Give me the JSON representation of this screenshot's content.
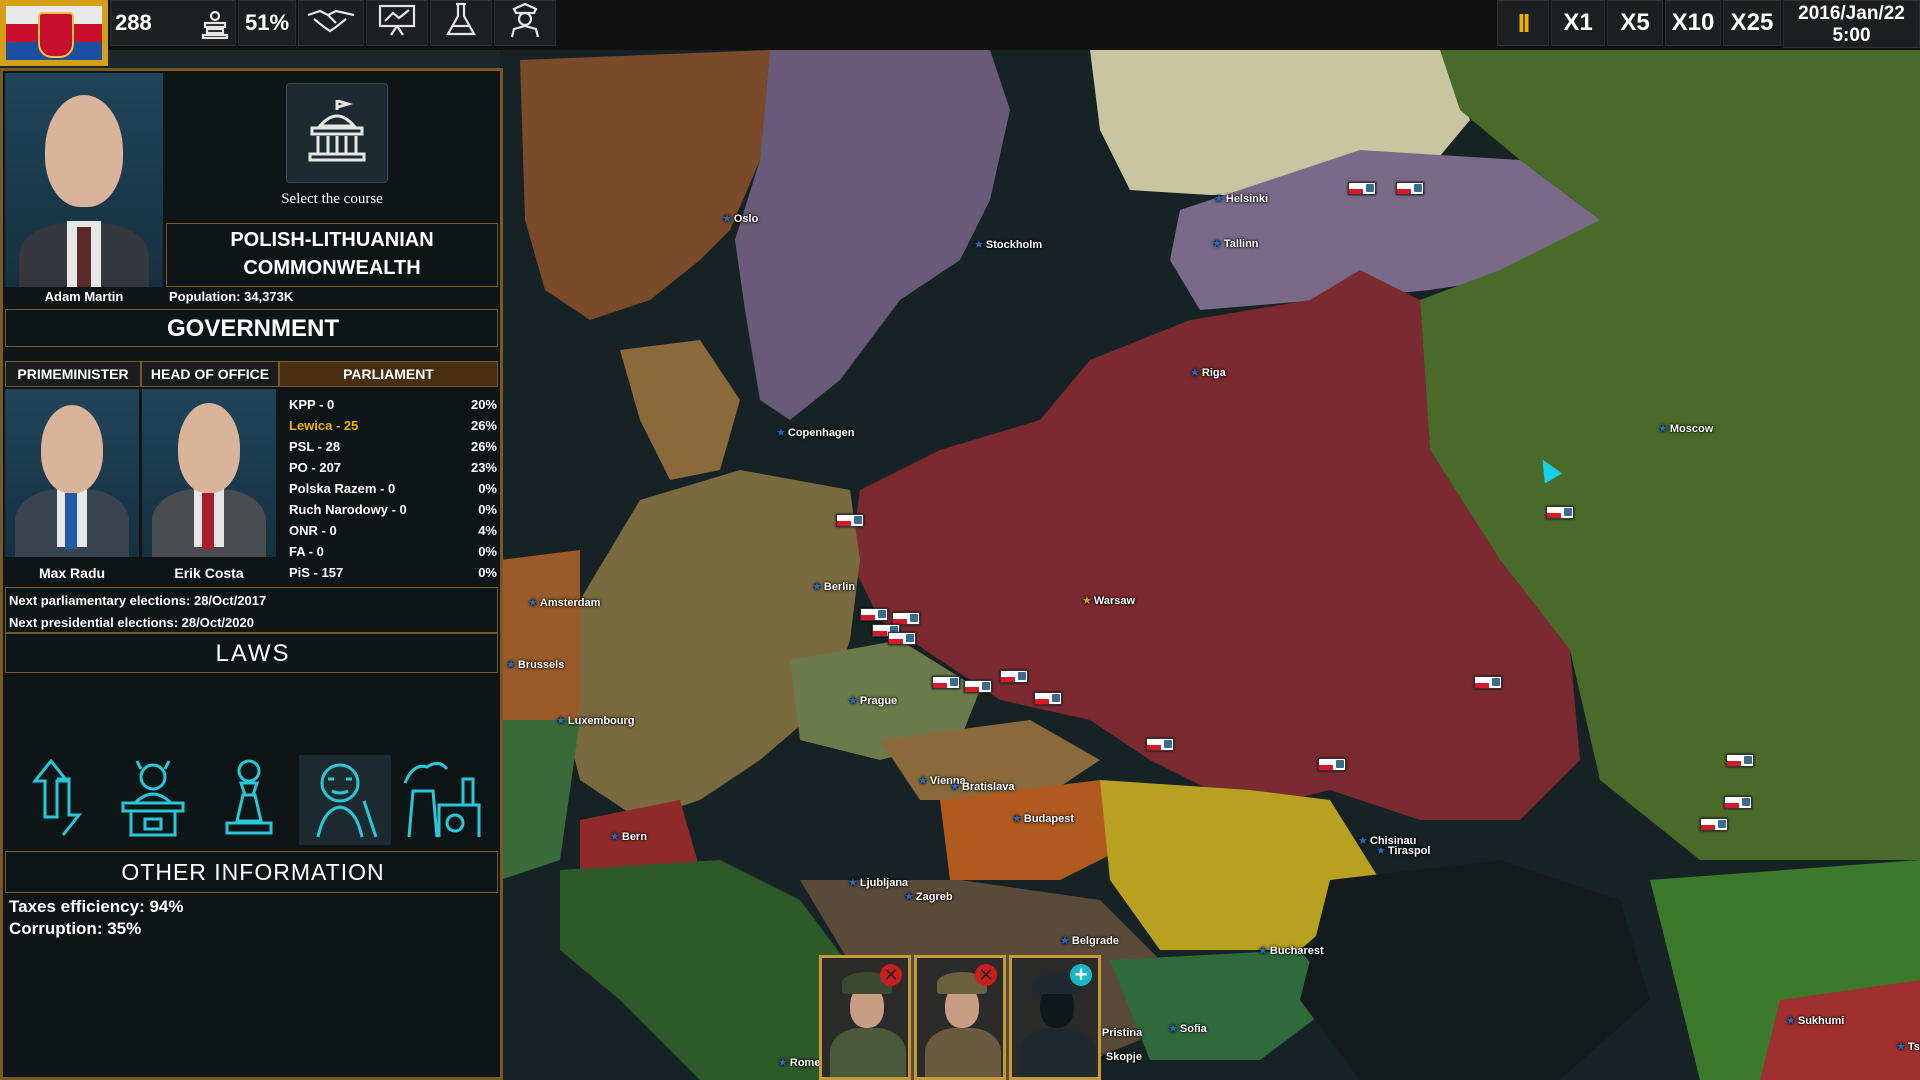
{
  "top_bar": {
    "resource_value": "288",
    "support_percent": "51%",
    "speed_buttons": [
      "X1",
      "X5",
      "X10",
      "X25"
    ],
    "pause_symbol": "II",
    "date": "2016/Jan/22",
    "time": "5:00",
    "icons": [
      "flag-icon",
      "tax-icon",
      "handshake-icon",
      "presentation-chart-icon",
      "flask-icon",
      "general-icon"
    ]
  },
  "leader": {
    "name": "Adam Martin",
    "course_label": "Select the course",
    "country_line1": "POLISH-LITHUANIAN",
    "country_line2": "COMMONWEALTH",
    "population": "Population: 34,373K"
  },
  "government": {
    "title": "GOVERNMENT",
    "pm_header": "PRIMEMINISTER",
    "head_header": "HEAD OF OFFICE",
    "parliament_header": "PARLIAMENT",
    "pm_name": "Max Radu",
    "head_name": "Erik Costa",
    "parties": [
      {
        "name": "KPP - 0",
        "pct": "20%",
        "highlight": false
      },
      {
        "name": "Lewica - 25",
        "pct": "26%",
        "highlight": true
      },
      {
        "name": "PSL - 28",
        "pct": "26%",
        "highlight": false
      },
      {
        "name": "PO - 207",
        "pct": "23%",
        "highlight": false
      },
      {
        "name": "Polska Razem - 0",
        "pct": "0%",
        "highlight": false
      },
      {
        "name": "Ruch Narodowy - 0",
        "pct": "0%",
        "highlight": false
      },
      {
        "name": "ONR - 0",
        "pct": "4%",
        "highlight": false
      },
      {
        "name": "FA - 0",
        "pct": "0%",
        "highlight": false
      },
      {
        "name": "PiS - 157",
        "pct": "0%",
        "highlight": false
      }
    ],
    "next_parliamentary": "Next parliamentary elections: 28/Oct/2017",
    "next_presidential": "Next presidential elections: 28/Oct/2020"
  },
  "laws": {
    "title": "LAWS",
    "icons": [
      "migration-arrows-icon",
      "official-desk-icon",
      "pawn-icon",
      "elderly-pension-icon",
      "nuclear-plant-icon"
    ]
  },
  "other_info": {
    "title": "OTHER INFORMATION",
    "taxes": "Taxes efficiency: 94%",
    "corruption": "Corruption: 35%"
  },
  "cities": [
    {
      "name": "Oslo",
      "capital": false
    },
    {
      "name": "Stockholm",
      "capital": false
    },
    {
      "name": "Helsinki",
      "capital": false
    },
    {
      "name": "Tallinn",
      "capital": false
    },
    {
      "name": "Riga",
      "capital": false
    },
    {
      "name": "Copenhagen",
      "capital": false
    },
    {
      "name": "Moscow",
      "capital": false
    },
    {
      "name": "Berlin",
      "capital": false
    },
    {
      "name": "Warsaw",
      "capital": true
    },
    {
      "name": "Amsterdam",
      "capital": false
    },
    {
      "name": "Brussels",
      "capital": false
    },
    {
      "name": "Luxembourg",
      "capital": false
    },
    {
      "name": "Prague",
      "capital": false
    },
    {
      "name": "Vienna",
      "capital": false
    },
    {
      "name": "Bratislava",
      "capital": false
    },
    {
      "name": "Budapest",
      "capital": false
    },
    {
      "name": "Bern",
      "capital": false
    },
    {
      "name": "Ljubljana",
      "capital": false
    },
    {
      "name": "Zagreb",
      "capital": false
    },
    {
      "name": "Belgrade",
      "capital": false
    },
    {
      "name": "Chisinau",
      "capital": false
    },
    {
      "name": "Tiraspol",
      "capital": false
    },
    {
      "name": "Bucharest",
      "capital": false
    },
    {
      "name": "Sofia",
      "capital": false
    },
    {
      "name": "Pristina",
      "capital": false
    },
    {
      "name": "Skopje",
      "capital": false
    },
    {
      "name": "Rome",
      "capital": false
    },
    {
      "name": "Sukhumi",
      "capital": false
    },
    {
      "name": "Tsk",
      "capital": false
    }
  ],
  "generals": [
    {
      "action": "remove",
      "symbol": "✕"
    },
    {
      "action": "remove",
      "symbol": "✕"
    },
    {
      "action": "add",
      "symbol": "+"
    }
  ],
  "colors": {
    "accent_gold": "#c49a34",
    "panel_border": "#7a5a22",
    "highlight_party": "#f0b400",
    "law_icon": "#28c8d8",
    "commonwealth_territory": "#7a2a30",
    "russia_territory": "#4a6a2a"
  }
}
